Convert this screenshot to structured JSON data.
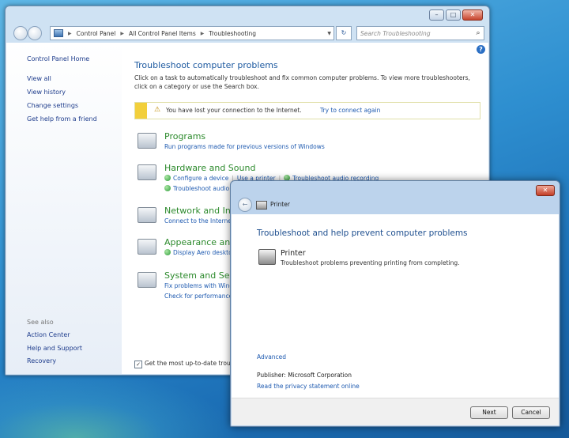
{
  "control_panel": {
    "address": {
      "segments": [
        "Control Panel",
        "All Control Panel Items",
        "Troubleshooting"
      ]
    },
    "search_placeholder": "Search Troubleshooting",
    "sidebar": {
      "home": "Control Panel Home",
      "links": [
        "View all",
        "View history",
        "Change settings",
        "Get help from a friend"
      ],
      "see_also_label": "See also",
      "see_also": [
        "Action Center",
        "Help and Support",
        "Recovery"
      ]
    },
    "main": {
      "title": "Troubleshoot computer problems",
      "intro": "Click on a task to automatically troubleshoot and fix common computer problems. To view more troubleshooters, click on a category or use the Search box.",
      "notice": {
        "message": "You have lost your connection to the Internet.",
        "action": "Try to connect again"
      },
      "categories": [
        {
          "title": "Programs",
          "links": [
            "Run programs made for previous versions of Windows"
          ]
        },
        {
          "title": "Hardware and Sound",
          "links": [
            "Configure a device",
            "Use a printer",
            "Troubleshoot audio recording",
            "Troubleshoot audio"
          ]
        },
        {
          "title": "Network and Inter",
          "links": [
            "Connect to the Internet"
          ]
        },
        {
          "title": "Appearance and P",
          "links": [
            "Display Aero deskto"
          ]
        },
        {
          "title": "System and Secur",
          "links": [
            "Fix problems with Wind",
            "Check for performance"
          ]
        }
      ],
      "bottom_checkbox": "Get the most up-to-date trou"
    }
  },
  "dialog": {
    "title": "Printer",
    "heading": "Troubleshoot and help prevent computer problems",
    "item_name": "Printer",
    "item_desc": "Troubleshoot problems preventing printing from completing.",
    "advanced": "Advanced",
    "publisher": "Publisher:  Microsoft Corporation",
    "privacy": "Read the privacy statement online",
    "next": "Next",
    "cancel": "Cancel"
  }
}
